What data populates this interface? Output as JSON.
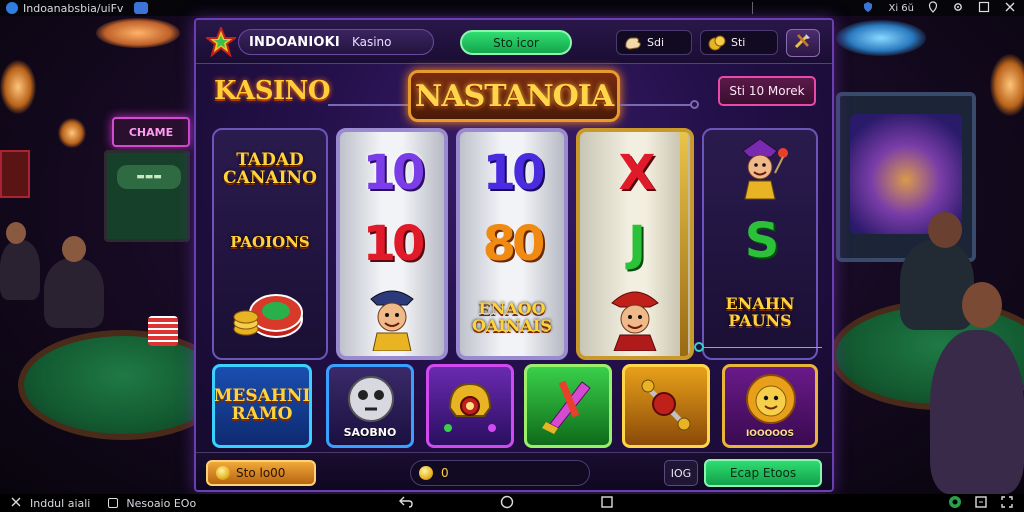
{
  "status_bar": {
    "app_title": "Indoanabsbia/uiFv",
    "time": "Xi 6ŭ"
  },
  "top_bar": {
    "brand_name": "INDOANIOKI",
    "brand_sub": "Kasino",
    "green_button": "Sto icor",
    "stat_1": "Sdi",
    "stat_2": "Sti",
    "tool_icon": "tools-icon"
  },
  "header": {
    "left_logo": "KASINO",
    "title": "NASTANOIA",
    "pink_button": "Sti 10 Morek"
  },
  "reels": {
    "reel1": {
      "top_word": "TADAD\nCANAINO",
      "mid_word": "PAOIONS",
      "bottom": "chip-stack-icon"
    },
    "reel2": {
      "top": "10",
      "mid": "10",
      "bottom": "pirate-character-icon"
    },
    "reel3": {
      "top": "10",
      "mid": "80",
      "bottom_word": "ENAOO\nOAINAIS"
    },
    "reel4": {
      "top": "X",
      "mid": "J",
      "bottom": "pirate-character-icon"
    },
    "reel5": {
      "top": "jester-character-icon",
      "mid": "S",
      "bottom_word": "ENAHN\nPAUNS"
    }
  },
  "tiles": [
    {
      "label": "MESAHNI\nRAMO",
      "icon": ""
    },
    {
      "label": "SAOBNO",
      "icon": "skull-ball-icon"
    },
    {
      "label": "",
      "icon": "gold-helmet-icon"
    },
    {
      "label": "",
      "icon": "sword-icon"
    },
    {
      "label": "",
      "icon": "mace-icon"
    },
    {
      "label": "IOOOOOS",
      "icon": "lion-icon"
    }
  ],
  "controls": {
    "coin_button": "Sto lo00",
    "balance": "0",
    "small_button": "IOG",
    "go_button": "Ecap Etoos"
  },
  "nav_bar": {
    "left_1": "Inddul aiali",
    "left_2": "Nesoaio EOo"
  }
}
